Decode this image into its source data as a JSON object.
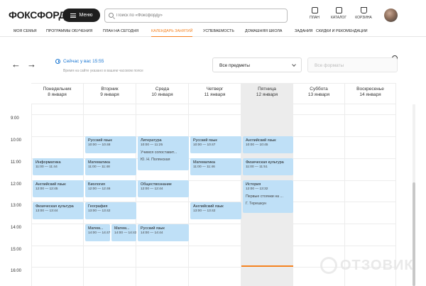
{
  "header": {
    "logo": "ФОКСФОРД",
    "menu_label": "Меню",
    "search_placeholder": "Поиск по «Фоксфорду»",
    "icons": [
      {
        "label": "ПЛАН",
        "icon": "plan-icon"
      },
      {
        "label": "КАТАЛОГ",
        "icon": "catalog-icon"
      },
      {
        "label": "КОРЗИНА",
        "icon": "cart-icon"
      }
    ]
  },
  "nav": [
    {
      "label": "МОЯ СЕМЬЯ",
      "active": false
    },
    {
      "label": "ПРОГРАММЫ ОБУЧЕНИЯ",
      "active": false
    },
    {
      "label": "ПЛАН НА СЕГОДНЯ",
      "active": false
    },
    {
      "label": "КАЛЕНДАРЬ ЗАНЯТИЙ",
      "active": true
    },
    {
      "label": "УСПЕВАЕМОСТЬ",
      "active": false
    },
    {
      "label": "ДОМАШНЯЯ ШКОЛА",
      "active": false
    },
    {
      "label": "ЗАДАНИЯ",
      "active": false
    },
    {
      "label": "СКИДКИ И РЕКОМЕНДАЦИИ",
      "active": false
    }
  ],
  "toolbar": {
    "now_label": "Сейчас у вас 15:55",
    "tz_note": "Время на сайте указано в вашем часовом поясе",
    "subjects_select": "Все предметы",
    "formats_select": "Все форматы"
  },
  "days": [
    {
      "name": "Понедельник",
      "date": "8 января",
      "today": false
    },
    {
      "name": "Вторник",
      "date": "9 января",
      "today": false
    },
    {
      "name": "Среда",
      "date": "10 января",
      "today": false
    },
    {
      "name": "Четверг",
      "date": "11 января",
      "today": false
    },
    {
      "name": "Пятница",
      "date": "12 января",
      "today": true
    },
    {
      "name": "Суббота",
      "date": "13 января",
      "today": false
    },
    {
      "name": "Воскресенье",
      "date": "14 января",
      "today": false
    }
  ],
  "times": [
    "9:00",
    "10:00",
    "11:00",
    "12:00",
    "13:00",
    "14:00",
    "15:00",
    "16:00"
  ],
  "events": {
    "mon_inf": {
      "title": "Информатика",
      "time": "11:00 — 11:44"
    },
    "mon_eng": {
      "title": "Английский язык",
      "time": "12:00 — 12:45"
    },
    "mon_phys": {
      "title": "Физическая культура",
      "time": "13:00 — 13:44"
    },
    "tue_rus": {
      "title": "Русский язык",
      "time": "10:00 — 10:48"
    },
    "tue_math": {
      "title": "Математика",
      "time": "11:00 — 11:48"
    },
    "tue_bio": {
      "title": "Биология",
      "time": "12:00 — 12:46"
    },
    "tue_geo": {
      "title": "География",
      "time": "13:00 — 13:42"
    },
    "tue_math2": {
      "title": "Матем...",
      "time": "14:00 — 14:47"
    },
    "tue_math3": {
      "title": "Матем...",
      "time": "14:00 — 14:43"
    },
    "wed_lit": {
      "title": "Литература",
      "time": "10:00 — 11:25",
      "extra": "Учимся сопоставит...",
      "extra2": "Ю. Н. Полянская"
    },
    "wed_soc": {
      "title": "Обществознание",
      "time": "12:00 — 12:44"
    },
    "wed_rus": {
      "title": "Русский язык",
      "time": "14:00 — 14:44"
    },
    "thu_rus": {
      "title": "Русский язык",
      "time": "10:00 — 10:47"
    },
    "thu_math": {
      "title": "Математика",
      "time": "11:00 — 11:46"
    },
    "thu_eng": {
      "title": "Английский язык",
      "time": "13:00 — 13:42"
    },
    "fri_eng": {
      "title": "Английский язык",
      "time": "10:00 — 10:45"
    },
    "fri_phys": {
      "title": "Физическая культура",
      "time": "11:00 — 11:51"
    },
    "fri_hist": {
      "title": "История",
      "time": "12:00 — 13:32",
      "extra": "Первые стоянки на ...",
      "extra2": "Г. Терешкун"
    }
  },
  "watermark": "ОТЗОВИК"
}
